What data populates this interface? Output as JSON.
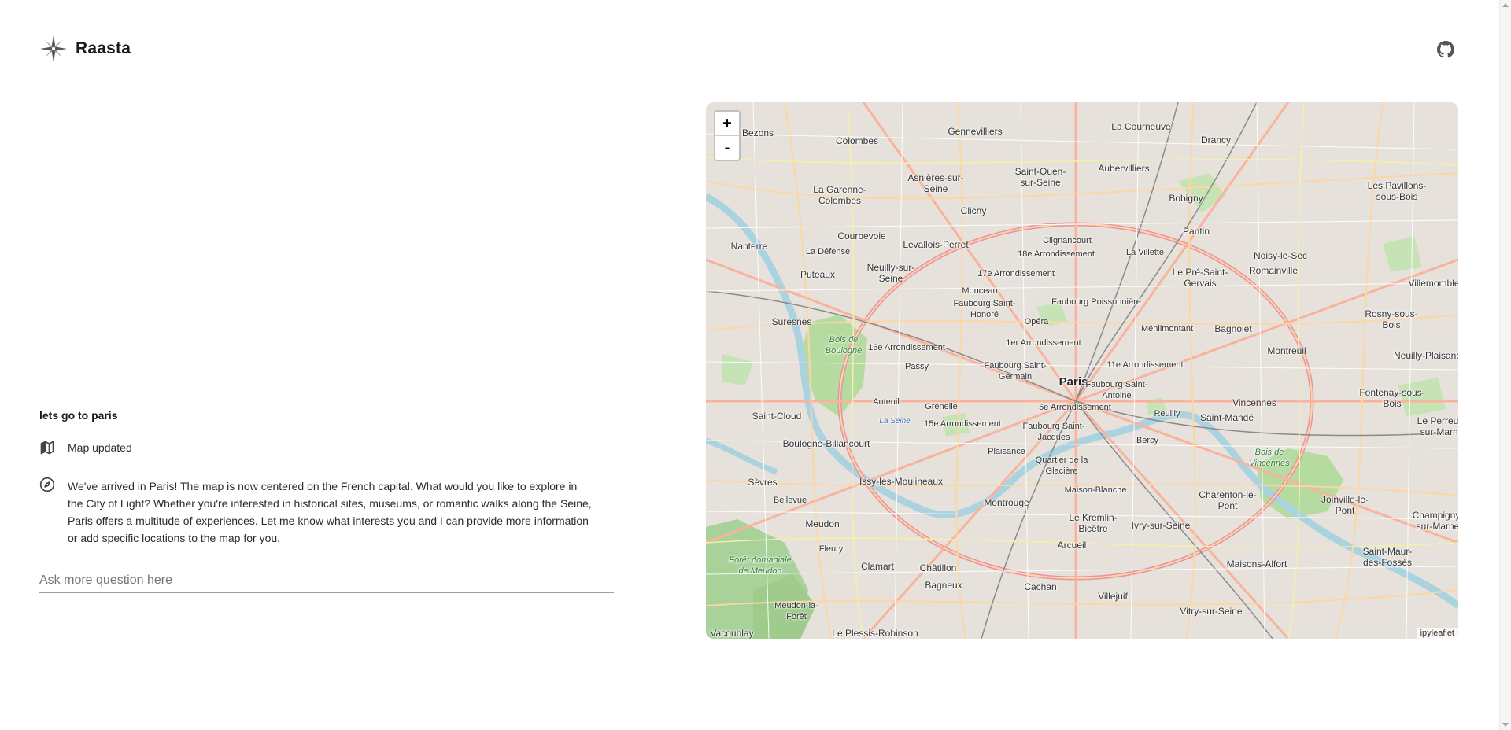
{
  "header": {
    "brand": "Raasta",
    "logo_icon": "compass-star-icon",
    "github_icon": "github-icon"
  },
  "chat": {
    "user_message": "lets go to paris",
    "events": [
      {
        "icon": "map-icon",
        "text": "Map updated"
      },
      {
        "icon": "compass-icon",
        "text": "We've arrived in Paris! The map is now centered on the French capital. What would you like to explore in the City of Light? Whether you're interested in historical sites, museums, or romantic walks along the Seine, Paris offers a multitude of experiences. Let me know what interests you and I can provide more information or add specific locations to the map for you."
      }
    ],
    "input": {
      "placeholder": "Ask more question here",
      "value": ""
    }
  },
  "map": {
    "zoom_in_label": "+",
    "zoom_out_label": "-",
    "attribution": "ipyleaflet",
    "labels": {
      "paris": "Paris",
      "bezons": "Bezons",
      "colombes": "Colombes",
      "gennevilliers": "Gennevilliers",
      "la_courneuve": "La Courneuve",
      "drancy": "Drancy",
      "aubervilliers": "Aubervilliers",
      "saint_ouen": "Saint-Ouen-sur-Seine",
      "asnieres": "Asnières-sur-Seine",
      "la_garenne": "La Garenne-Colombes",
      "bobigny": "Bobigny",
      "les_pavillons": "Les Pavillons-sous-Bois",
      "clichy": "Clichy",
      "pantin": "Pantin",
      "nanterre": "Nanterre",
      "courbevoie": "Courbevoie",
      "levallois": "Levallois-Perret",
      "clignancourt": "Clignancourt",
      "arr18": "18e Arrondissement",
      "la_villette": "La Villette",
      "noisy": "Noisy-le-Sec",
      "la_defense": "La Défense",
      "puteaux": "Puteaux",
      "neuilly": "Neuilly-sur-Seine",
      "arr17": "17e Arrondissement",
      "le_pre": "Le Pré-Saint-Gervais",
      "romainville": "Romainville",
      "villemomble": "Villemomble",
      "monceau": "Monceau",
      "faubourg_honore": "Faubourg Saint-Honoré",
      "faubourg_poissonniere": "Faubourg Poissonnière",
      "opera": "Opéra",
      "suresnes": "Suresnes",
      "menilmontant": "Ménilmontant",
      "bagnolet": "Bagnolet",
      "rosny": "Rosny-sous-Bois",
      "bois_boulogne": "Bois de Boulogne",
      "arr16": "16e Arrondissement",
      "arr1": "1er Arrondissement",
      "montreuil": "Montreuil",
      "passy": "Passy",
      "faubourg_germain": "Faubourg Saint-Germain",
      "arr11": "11e Arrondissement",
      "neuilly_plaisance": "Neuilly-Plaisance",
      "faubourg_antoine": "Faubourg Saint-Antoine",
      "auteuil": "Auteuil",
      "grenelle": "Grenelle",
      "arr5": "5e Arrondissement",
      "vincennes": "Vincennes",
      "fontenay": "Fontenay-sous-Bois",
      "saint_cloud": "Saint-Cloud",
      "la_seine": "La Seine",
      "arr15": "15e Arrondissement",
      "faubourg_jacques": "Faubourg Saint-Jacques",
      "reuilly": "Reuilly",
      "saint_mande": "Saint-Mandé",
      "le_perreux": "Le Perreux-sur-Marne",
      "boulogne": "Boulogne-Billancourt",
      "bercy": "Bercy",
      "plaisance": "Plaisance",
      "bois_vincennes": "Bois de Vincennes",
      "quartier_glaciere": "Quartier de la Glacière",
      "sevres": "Sèvres",
      "issy": "Issy-les-Moulineaux",
      "maison_blanche": "Maison-Blanche",
      "charenton": "Charenton-le-Pont",
      "joinville": "Joinville-le-Pont",
      "champigny": "Champigny-sur-Marne",
      "bellevue": "Bellevue",
      "montrouge": "Montrouge",
      "meudon": "Meudon",
      "le_kremlin": "Le Kremlin-Bicêtre",
      "ivry": "Ivry-sur-Seine",
      "fleury": "Fleury",
      "arcueil": "Arcueil",
      "foret_meudon": "Forêt domaniale de Meudon",
      "clamart": "Clamart",
      "chatillon": "Châtillon",
      "maisons_alfort": "Maisons-Alfort",
      "saint_maur": "Saint-Maur-des-Fossés",
      "bagneux": "Bagneux",
      "cachan": "Cachan",
      "villejuif": "Villejuif",
      "meudon_foret": "Meudon-la-Forêt",
      "vitry": "Vitry-sur-Seine",
      "le_plessis": "Le Plessis-Robinson",
      "vacoublay": "Vacoublay"
    }
  }
}
